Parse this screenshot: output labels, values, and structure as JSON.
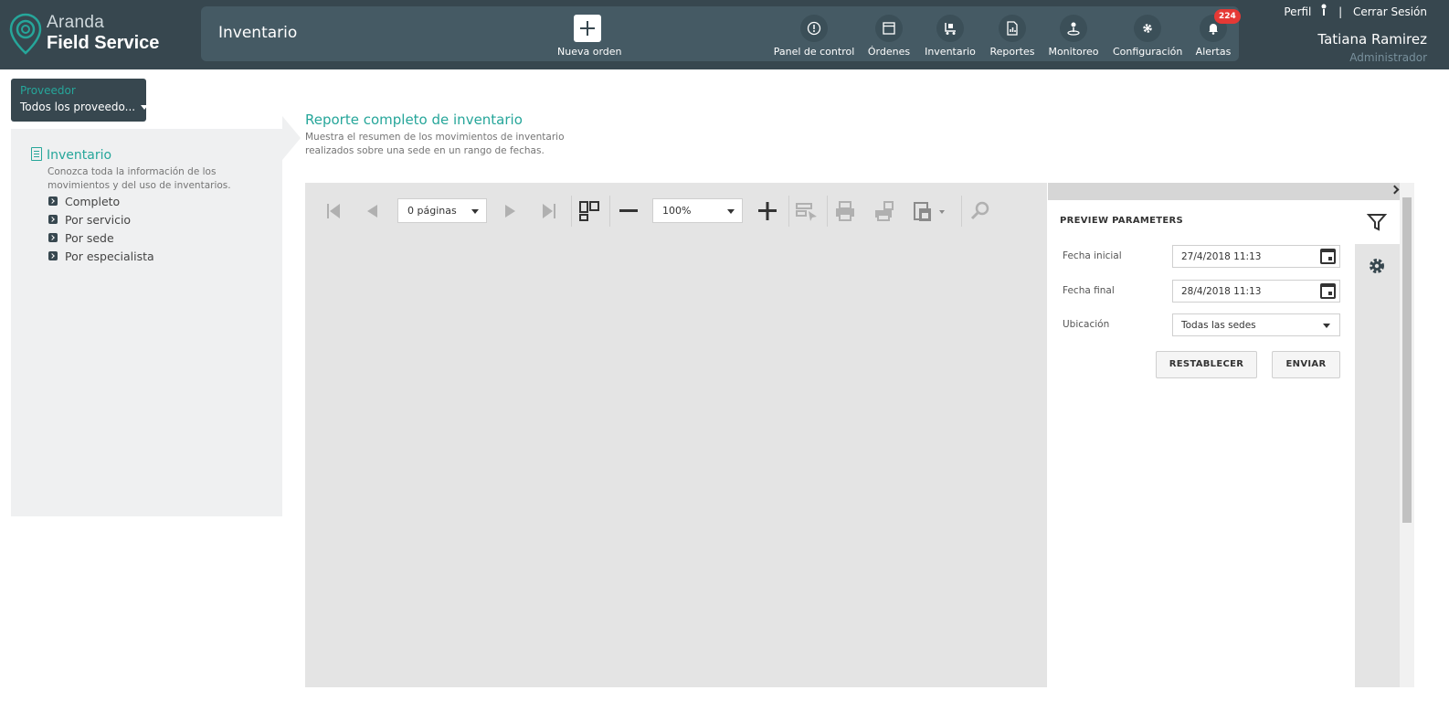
{
  "brand": {
    "line1": "Aranda",
    "line2": "Field Service"
  },
  "header": {
    "page_title": "Inventario",
    "new_order_label": "Nueva orden",
    "nav": [
      {
        "label": "Panel de control",
        "icon": "dashboard-icon"
      },
      {
        "label": "Órdenes",
        "icon": "orders-icon"
      },
      {
        "label": "Inventario",
        "icon": "inventory-icon"
      },
      {
        "label": "Reportes",
        "icon": "reports-icon"
      },
      {
        "label": "Monitoreo",
        "icon": "monitoring-icon"
      },
      {
        "label": "Configuración",
        "icon": "settings-icon"
      },
      {
        "label": "Alertas",
        "icon": "bell-icon",
        "badge": "224"
      }
    ],
    "user": {
      "profile_link": "Perfil",
      "logout_link": "Cerrar Sesión",
      "name": "Tatiana Ramirez",
      "role": "Administrador"
    }
  },
  "provider": {
    "label": "Proveedor",
    "value": "Todos los proveedo..."
  },
  "sidebar": {
    "title": "Inventario",
    "description": "Conozca toda la información de los movimientos y del uso de inventarios.",
    "items": [
      {
        "label": "Completo"
      },
      {
        "label": "Por servicio"
      },
      {
        "label": "Por sede"
      },
      {
        "label": "Por especialista"
      }
    ]
  },
  "report": {
    "title": "Reporte completo de inventario",
    "description": "Muestra el resumen de los movimientos de inventario realizados sobre una sede en un rango de fechas."
  },
  "viewer": {
    "pages_select": "0 páginas",
    "zoom_select": "100%"
  },
  "params": {
    "title": "PREVIEW PARAMETERS",
    "fields": [
      {
        "label": "Fecha inicial",
        "value": "27/4/2018 11:13"
      },
      {
        "label": "Fecha final",
        "value": "28/4/2018 11:13"
      },
      {
        "label": "Ubicación",
        "value": "Todas las sedes"
      }
    ],
    "reset_label": "RESTABLECER",
    "submit_label": "ENVIAR"
  },
  "colors": {
    "header_bg": "#37474f",
    "title_bar_bg": "#455a64",
    "accent": "#26a69a",
    "badge": "#e53935"
  }
}
